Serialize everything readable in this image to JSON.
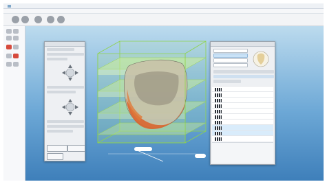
{
  "window": {
    "title": ""
  },
  "menubar": [],
  "toolbar_icons": [
    "tooth-tool-icon",
    "tooth-tool-icon",
    "tooth-tool-icon",
    "tooth-tool-icon",
    "tooth-tool-icon"
  ],
  "left_panel": {
    "title": "",
    "buttons": {
      "primary": "",
      "secondary": "",
      "bottom": ""
    }
  },
  "right_panel": {
    "title": "",
    "rows": [
      "",
      "",
      "",
      "",
      "",
      "",
      "",
      "",
      "",
      ""
    ],
    "selected_rows": [
      7,
      8
    ]
  },
  "colors": {
    "viewport_top": "#bcdbee",
    "viewport_bottom": "#3e7fba",
    "bounding_box": "#8fd34a",
    "model": "#d9652e",
    "selection": "#d9ecfb"
  }
}
